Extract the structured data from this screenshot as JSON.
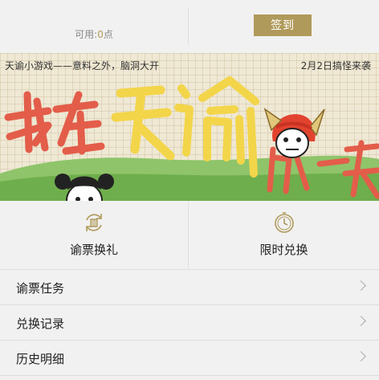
{
  "header": {
    "points_label": "可用:",
    "points_value": "0",
    "points_unit": "点",
    "signin_label": "签到"
  },
  "banner": {
    "caption_left": "天谕小游戏——意料之外，脑洞大开",
    "caption_right": "2月2日搞怪来袭",
    "title_art": "我在天谕的一天"
  },
  "cards": [
    {
      "label": "谕票换礼",
      "icon": "exchange-ticket-icon"
    },
    {
      "label": "限时兑换",
      "icon": "clock-icon"
    }
  ],
  "menu": [
    {
      "label": "谕票任务"
    },
    {
      "label": "兑换记录"
    },
    {
      "label": "历史明细"
    }
  ],
  "colors": {
    "accent": "#b09a5b",
    "background": "#f1f1f1"
  }
}
